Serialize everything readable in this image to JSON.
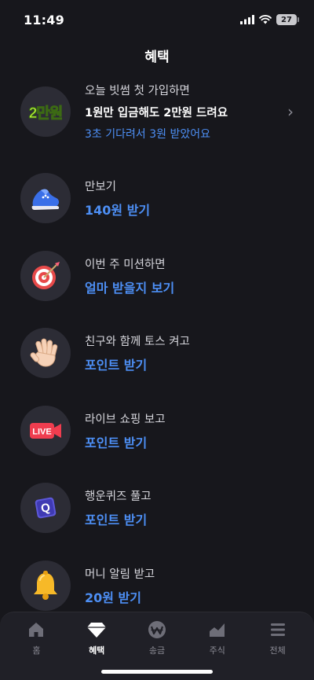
{
  "status": {
    "time": "11:49",
    "battery": "27"
  },
  "page": {
    "title": "혜택"
  },
  "promo": {
    "badge": "2만원",
    "label": "오늘 빗썸 첫 가입하면",
    "headline": "1원만 입금해도 2만원 드려요",
    "sub": "3초 기다려서 3원 받았어요"
  },
  "benefits": [
    {
      "label": "만보기",
      "action": "140원 받기",
      "icon": "sneaker-icon"
    },
    {
      "label": "이번 주 미션하면",
      "action": "얼마 받을지 보기",
      "icon": "dart-target-icon"
    },
    {
      "label": "친구와 함께 토스 켜고",
      "action": "포인트 받기",
      "icon": "waving-hand-icon"
    },
    {
      "label": "라이브 쇼핑 보고",
      "action": "포인트 받기",
      "icon": "live-camera-icon",
      "icon_text": "LIVE"
    },
    {
      "label": "행운퀴즈 풀고",
      "action": "포인트 받기",
      "icon": "quiz-cube-icon",
      "icon_text": "Q"
    },
    {
      "label": "머니 알림 받고",
      "action": "20원 받기",
      "icon": "bell-icon"
    }
  ],
  "tabs": [
    {
      "label": "홈",
      "icon": "home-icon",
      "active": false
    },
    {
      "label": "혜택",
      "icon": "diamond-icon",
      "active": true
    },
    {
      "label": "송금",
      "icon": "money-transfer-icon",
      "active": false
    },
    {
      "label": "주식",
      "icon": "stock-chart-icon",
      "active": false
    },
    {
      "label": "전체",
      "icon": "menu-icon",
      "active": false
    }
  ],
  "colors": {
    "background": "#17171c",
    "accent": "#4d8ff5",
    "tab_bar": "#202027"
  }
}
